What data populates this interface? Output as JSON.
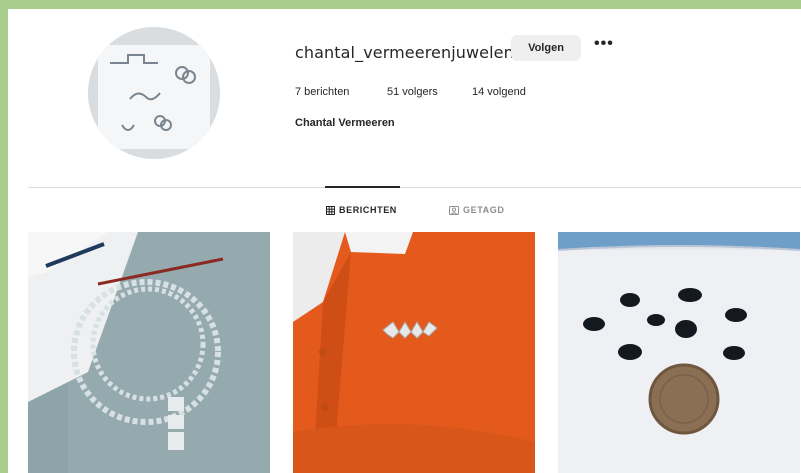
{
  "profile": {
    "username": "chantal_vermeerenjuwelen",
    "follow_label": "Volgen",
    "more_label": "•••",
    "full_name": "Chantal Vermeeren",
    "avatar_icon": "jewelry-sketch-avatar",
    "stats": {
      "posts": "7 berichten",
      "followers": "51 volgers",
      "following": "14 volgend"
    }
  },
  "tabs": [
    {
      "label": "BERICHTEN",
      "icon": "grid-icon",
      "active": true
    },
    {
      "label": "GETAGD",
      "icon": "tag-icon",
      "active": false
    }
  ],
  "posts": [
    {
      "icon": "necklace-drawing-photo"
    },
    {
      "icon": "fish-brooch-photo"
    },
    {
      "icon": "mussel-shells-photo"
    }
  ],
  "colors": {
    "window_border": "#a8cc8c",
    "follow_button_bg": "#efefef",
    "text": "#262626",
    "muted": "#8e8e8e"
  }
}
